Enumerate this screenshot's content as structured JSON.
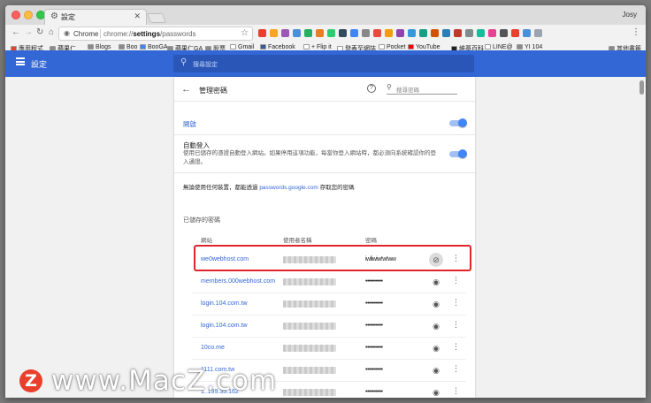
{
  "tab": {
    "title": "設定",
    "profile_name": "Josy"
  },
  "toolbar": {
    "scheme": "Chrome",
    "url_prefix": "chrome://",
    "url_bold": "settings",
    "url_suffix": "/passwords"
  },
  "bookmarks": [
    {
      "label": "應用程式",
      "icon_color": "#e8402c"
    },
    {
      "label": "蘋果仁",
      "icon_color": "#8a8a8a"
    },
    {
      "label": "Blogs",
      "icon_color": "#8a8a8a"
    },
    {
      "label": "Boo",
      "icon_color": "#8a8a8a"
    },
    {
      "label": "BooGA",
      "icon_color": "#4285f4"
    },
    {
      "label": "蘋果仁GA",
      "icon_color": "#8a8a8a"
    },
    {
      "label": "股票",
      "icon_color": "#8a8a8a"
    },
    {
      "label": "Gmail",
      "icon_color": "#ffffff"
    },
    {
      "label": "Facebook",
      "icon_color": "#3b5998"
    },
    {
      "label": "+ Flip it",
      "icon_color": "#ffffff"
    },
    {
      "label": "發表至網誌",
      "icon_color": "#ffffff"
    },
    {
      "label": "Pocket",
      "icon_color": "#ffffff"
    },
    {
      "label": "YouTube",
      "icon_color": "#ff0000"
    },
    {
      "label": "維基百科",
      "icon_color": "#222222"
    },
    {
      "label": "LINE@",
      "icon_color": "#ffffff"
    },
    {
      "label": "YI 104",
      "icon_color": "#8a8a8a"
    },
    {
      "label": "其他書籤",
      "icon_color": "#8a8a8a"
    }
  ],
  "header": {
    "title": "設定",
    "search_placeholder": "搜尋設定"
  },
  "card": {
    "title": "管理密碼",
    "search_placeholder": "搜尋密碼",
    "offer_label": "開啟",
    "autosignin_title": "自動登入",
    "autosignin_desc": "使用已儲存的憑證自動登入網站。如果停用這項功能，每當你登入網站時，都必須向系統確認你的登入通證。",
    "account_note_before": "無論使用任何裝置，都能透過 ",
    "account_note_link": "passwords.google.com",
    "account_note_after": " 存取您的密碼",
    "saved_heading": "已儲存的密碼",
    "columns": {
      "site": "網站",
      "user": "使用者名稱",
      "password": "密碼"
    }
  },
  "passwords": [
    {
      "site": "we0webhost.com",
      "password": "iwliwiw!w!ww",
      "revealed": true
    },
    {
      "site": "members.000webhost.com",
      "password": "••••••••••",
      "revealed": false
    },
    {
      "site": "login.104.com.tw",
      "password": "••••••••••",
      "revealed": false
    },
    {
      "site": "login.104.com.tw",
      "password": "••••••••••",
      "revealed": false
    },
    {
      "site": "10co.me",
      "password": "••••••••••",
      "revealed": false
    },
    {
      "site": "1111.com.tw",
      "password": "••••••••••",
      "revealed": false
    },
    {
      "site": "1..199.35.162",
      "password": "••••••••••",
      "revealed": false
    }
  ],
  "watermark": {
    "logo_letter": "Z",
    "text": "www.MacZ.com"
  },
  "colors": {
    "accent": "#3367d6",
    "header": "#3367d6",
    "highlight": "#e0252b"
  }
}
